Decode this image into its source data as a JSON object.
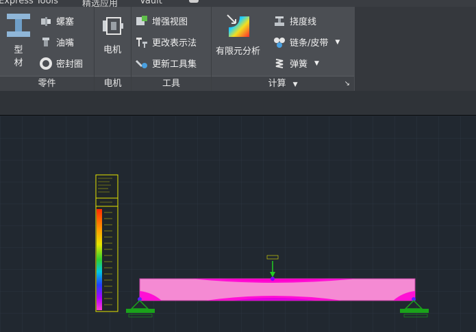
{
  "tabs": [
    "Express Tools",
    "精选应用",
    "Vault"
  ],
  "panels": {
    "parts": {
      "title": "零件",
      "large_button": {
        "line1": "型",
        "line2": "材",
        "icon": "i-beam-icon"
      },
      "items": [
        {
          "label": "螺塞",
          "icon": "plug-icon"
        },
        {
          "label": "油嘴",
          "icon": "grease-nipple-icon"
        },
        {
          "label": "密封圈",
          "icon": "seal-ring-icon"
        }
      ]
    },
    "motor": {
      "title": "电机",
      "large_button": {
        "label": "电机",
        "icon": "motor-icon"
      }
    },
    "tools": {
      "title": "工具",
      "items": [
        {
          "label": "增强视图",
          "icon": "enhanced-view-icon"
        },
        {
          "label": "更改表示法",
          "icon": "change-representation-icon"
        },
        {
          "label": "更新工具集",
          "icon": "update-toolset-icon"
        }
      ]
    },
    "calc": {
      "title": "计算",
      "large_button": {
        "label": "有限元分析",
        "icon": "fea-icon"
      },
      "items": [
        {
          "label": "挠度线",
          "icon": "deflection-icon"
        },
        {
          "label": "链条/皮带",
          "icon": "chain-belt-icon"
        },
        {
          "label": "弹簧",
          "icon": "spring-icon"
        }
      ]
    }
  },
  "colors": {
    "ribbon_bg": "#4b4e53",
    "canvas_bg": "#212830",
    "beam_fill": "#f58ad3",
    "stress_high": "#ff00d2",
    "support": "#1aa31a",
    "legend_yellow": "#e6e600",
    "load_arrow": "#22cc22"
  }
}
